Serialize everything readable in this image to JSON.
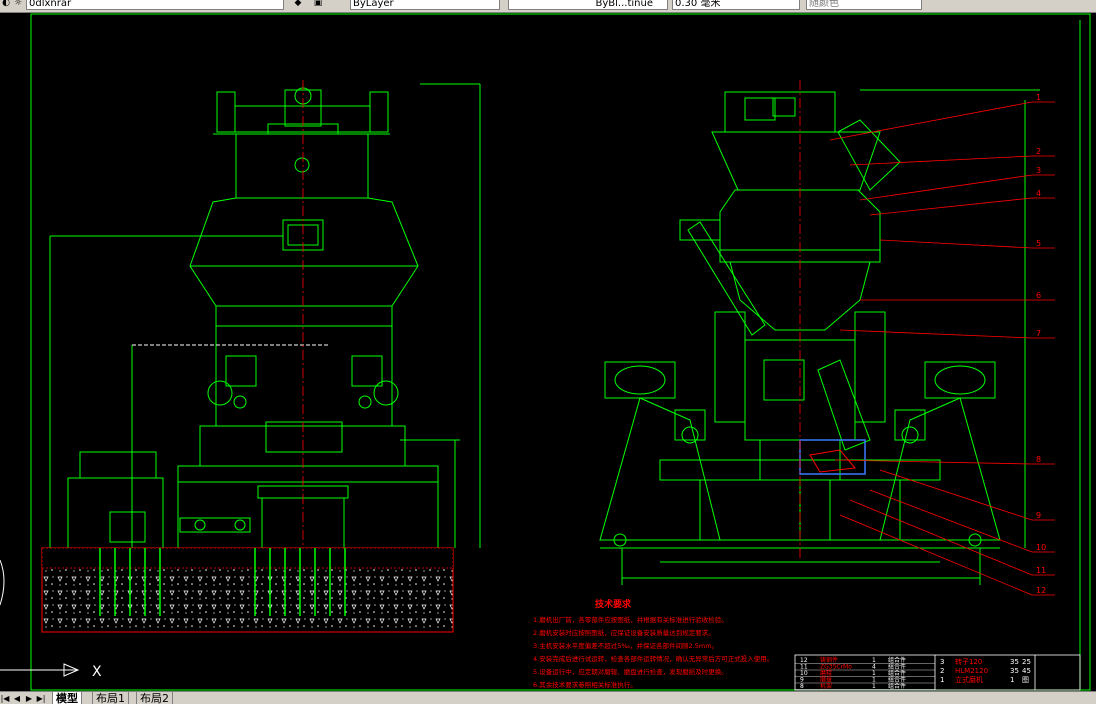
{
  "toolbar": {
    "layer_value": "0dlxnrar",
    "color_value": "ByLayer",
    "linetype_value": "ByBl...tinue",
    "lineweight_value": "0.30 毫米",
    "plotstyle_value": "随颜色"
  },
  "drawing": {
    "balloons": [
      "1",
      "2",
      "3",
      "4",
      "5",
      "6",
      "7",
      "8",
      "9",
      "10",
      "11",
      "12"
    ],
    "tech_req": {
      "title": "技术要求",
      "lines": [
        "1.磨机出厂前，各零部件应按图纸，并根据有关标准进行验收检验。",
        "2.磨机安装时应按照图纸，应保证设备安装质量达到规定要求。",
        "3.主机安装水平度偏差不超过5‰，并保证各部件间隙2.5mm。",
        "4.安装完成后进行试运转，检查各部件运转情况，确认无异常后方可正式投入使用。",
        "5.设备运行中，应定期对磨辊、磨盘进行检查，发现磨损及时更换。",
        "6.其余技术要求参照相关标准执行。"
      ]
    },
    "title_block": {
      "rows": [
        {
          "no": "12",
          "name": "铸钢件",
          "qty": "1",
          "mat": "组合件"
        },
        {
          "no": "11",
          "name": "ZG35CrMo",
          "qty": "4",
          "mat": "组合件"
        },
        {
          "no": "10",
          "name": "磨辊",
          "qty": "1",
          "mat": "组合件"
        },
        {
          "no": "9",
          "name": "磨盘",
          "qty": "1",
          "mat": "组合件"
        },
        {
          "no": "8",
          "name": "机架",
          "qty": "1",
          "mat": "组合件"
        }
      ],
      "right_rows": [
        {
          "no": "3",
          "name": "转子120",
          "c1": "35",
          "c2": "25"
        },
        {
          "no": "2",
          "name": "HLM2120",
          "c1": "35",
          "c2": "45"
        },
        {
          "no": "1",
          "name": "立式磨机",
          "c1": "1",
          "c2": "图"
        }
      ]
    },
    "axis_x_label": "X"
  },
  "tabs": [
    "模型",
    "布局1",
    "布局2"
  ],
  "colors": {
    "lines": "#00ff00",
    "white": "#ffffff",
    "red": "#ff0000",
    "blue": "#3a7bff",
    "bg": "#000000"
  }
}
